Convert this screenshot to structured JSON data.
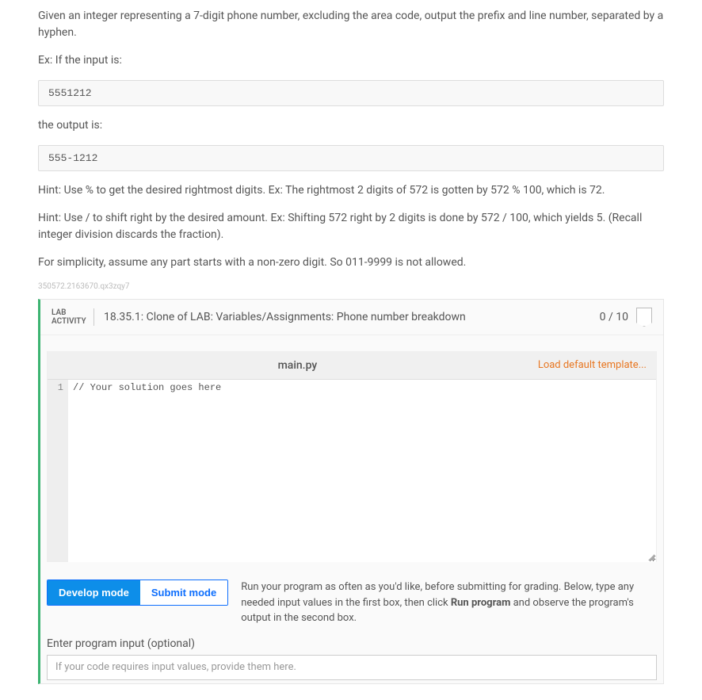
{
  "problem": {
    "intro": "Given an integer representing a 7-digit phone number, excluding the area code, output the prefix and line number, separated by a hyphen.",
    "ex_label": "Ex: If the input is:",
    "input_sample": "5551212",
    "output_label": "the output is:",
    "output_sample": "555-1212",
    "hint1": "Hint: Use % to get the desired rightmost digits. Ex: The rightmost 2 digits of 572 is gotten by 572 % 100, which is 72.",
    "hint2": "Hint: Use / to shift right by the desired amount. Ex: Shifting 572 right by 2 digits is done by 572 / 100, which yields 5. (Recall integer division discards the fraction).",
    "simplicity": "For simplicity, assume any part starts with a non-zero digit. So 011-9999 is not allowed.",
    "small_id": "350572.2163670.qx3zqy7"
  },
  "lab": {
    "badge_line1": "LAB",
    "badge_line2": "ACTIVITY",
    "title": "18.35.1: Clone of LAB: Variables/Assignments: Phone number breakdown",
    "score": "0 / 10"
  },
  "editor": {
    "filename": "main.py",
    "load_template": "Load default template...",
    "line_number": "1",
    "starter_code": "// Your solution goes here"
  },
  "modes": {
    "develop": "Develop mode",
    "submit": "Submit mode",
    "instructions_pre": "Run your program as often as you'd like, before submitting for grading. Below, type any needed input values in the first box, then click ",
    "instructions_bold": "Run program",
    "instructions_post": " and observe the program's output in the second box."
  },
  "input": {
    "label": "Enter program input (optional)",
    "placeholder": "If your code requires input values, provide them here."
  }
}
